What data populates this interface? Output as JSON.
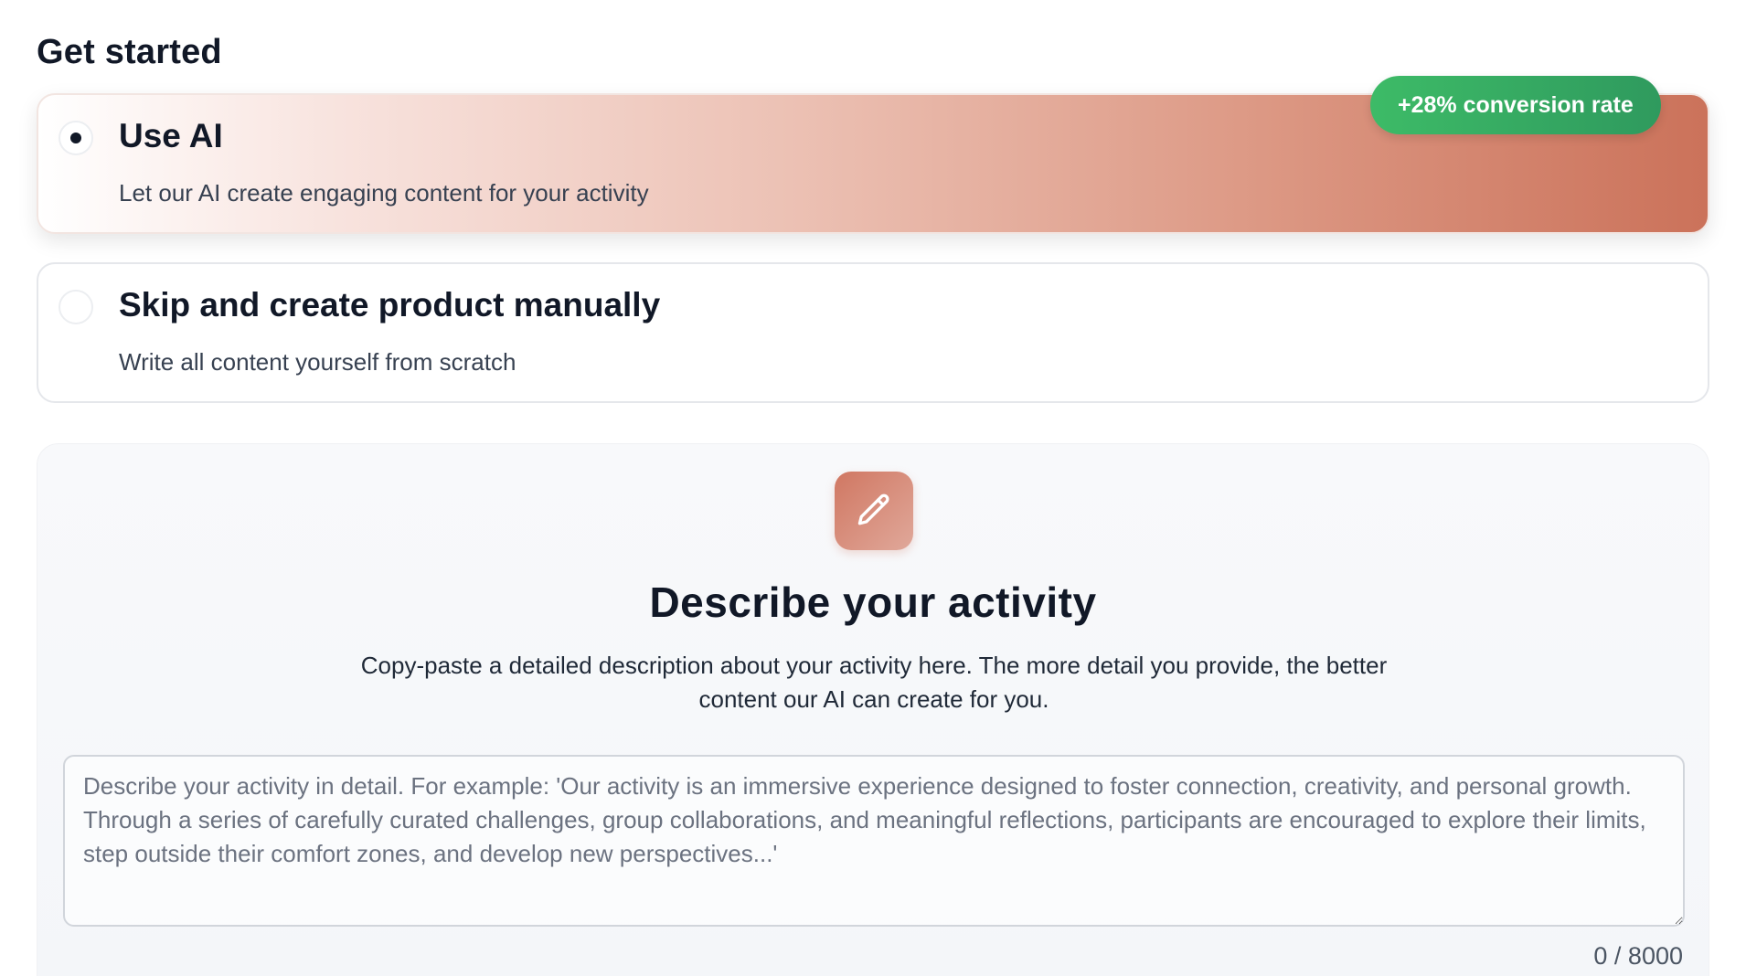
{
  "page": {
    "title": "Get started"
  },
  "options": [
    {
      "title": "Use AI",
      "description": "Let our AI create engaging content for your activity",
      "selected": true,
      "badge": "+28% conversion rate"
    },
    {
      "title": "Skip and create product manually",
      "description": "Write all content yourself from scratch",
      "selected": false
    }
  ],
  "describe": {
    "icon": "pencil-icon",
    "title": "Describe your activity",
    "subtitle": "Copy-paste a detailed description about your activity here. The more detail you provide, the better content our AI can create for you.",
    "input_value": "",
    "placeholder": "Describe your activity in detail. For example: 'Our activity is an immersive experience designed to foster connection, creativity, and personal growth. Through a series of carefully curated challenges, group collaborations, and meaningful reflections, participants are encouraged to explore their limits, step outside their comfort zones, and develop new perspectives...'",
    "counter": "0 / 8000"
  },
  "colors": {
    "accent": "#d07762",
    "badge_green": "#3dbb67",
    "text_primary": "#111827"
  }
}
